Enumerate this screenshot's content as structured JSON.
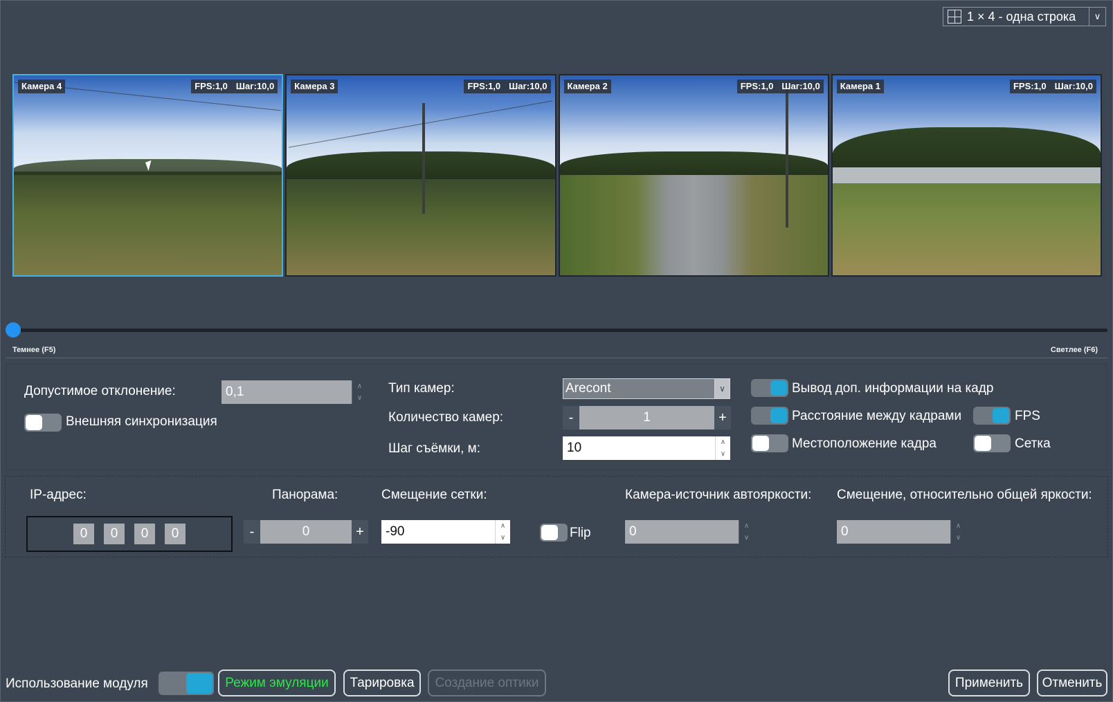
{
  "layout": {
    "selected": "1 × 4 - одна строка",
    "icon": "grid-icon"
  },
  "cameras": [
    {
      "name": "Камера 4",
      "fps": "FPS:1,0",
      "step": "Шаг:10,0",
      "selected": true
    },
    {
      "name": "Камера 3",
      "fps": "FPS:1,0",
      "step": "Шаг:10,0",
      "selected": false
    },
    {
      "name": "Камера 2",
      "fps": "FPS:1,0",
      "step": "Шаг:10,0",
      "selected": false
    },
    {
      "name": "Камера 1",
      "fps": "FPS:1,0",
      "step": "Шаг:10,0",
      "selected": false
    }
  ],
  "brightness": {
    "darker_label": "Темнее (F5)",
    "brighter_label": "Светлее (F6)",
    "level": 0
  },
  "settings": {
    "tolerance_label": "Допустимое отклонение:",
    "tolerance_value": "0,1",
    "ext_sync_label": "Внешняя синхронизация",
    "ext_sync_on": false,
    "camera_type_label": "Тип камер:",
    "camera_type_value": "Arecont",
    "camera_count_label": "Количество камер:",
    "camera_count_value": "1",
    "shoot_step_label": "Шаг съёмки, м:",
    "shoot_step_value": "10",
    "extra_info_label": "Вывод доп. информации на кадр",
    "extra_info_on": true,
    "frame_distance_label": "Расстояние между кадрами",
    "frame_distance_on": true,
    "fps_label": "FPS",
    "fps_on": true,
    "frame_location_label": "Местоположение кадра",
    "frame_location_on": false,
    "grid_label": "Сетка",
    "grid_on": false
  },
  "camera_settings": {
    "ip_label": "IP-адрес:",
    "ip_octets": [
      "0",
      "0",
      "0",
      "0"
    ],
    "panorama_label": "Панорама:",
    "panorama_value": "0",
    "grid_offset_label": "Смещение сетки:",
    "grid_offset_value": "-90",
    "flip_label": "Flip",
    "flip_on": false,
    "auto_bright_source_label": "Камера-источник автояркости:",
    "auto_bright_source_value": "0",
    "bright_offset_label": "Смещение, относительно общей яркости:",
    "bright_offset_value": "0"
  },
  "footer": {
    "module_usage_label": "Использование модуля",
    "module_usage_on": true,
    "emulation_button": "Режим эмуляции",
    "calibration_button": "Тарировка",
    "optics_button": "Создание оптики",
    "apply_button": "Применить",
    "cancel_button": "Отменить"
  },
  "colors": {
    "background": "#3c4652",
    "accent": "#21a6d6",
    "selection": "#43b1e6",
    "emulation": "#2ee64b"
  }
}
